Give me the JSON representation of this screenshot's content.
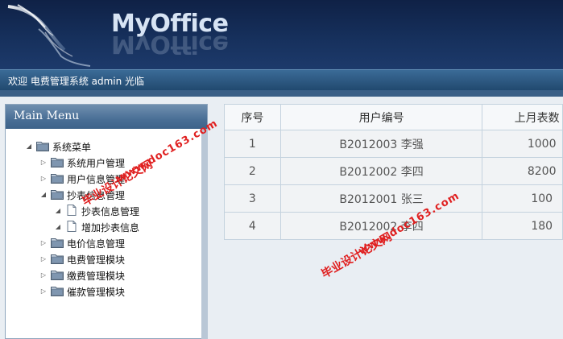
{
  "header": {
    "app_title": "MyOffice"
  },
  "welcome_bar": {
    "text": "欢迎 电费管理系统 admin 光临"
  },
  "sidebar": {
    "title": "Main Menu",
    "tree": [
      {
        "label": "系统菜单",
        "toggle": "◢",
        "icon": "folder-icon",
        "level": 0
      },
      {
        "label": "系统用户管理",
        "toggle": "▷",
        "icon": "folder-icon",
        "level": 1
      },
      {
        "label": "用户信息管理",
        "toggle": "▷",
        "icon": "folder-icon",
        "level": 1
      },
      {
        "label": "抄表信息管理",
        "toggle": "◢",
        "icon": "folder-icon",
        "level": 1
      },
      {
        "label": "抄表信息管理",
        "toggle": "◢",
        "icon": "document-icon",
        "level": 2
      },
      {
        "label": "增加抄表信息",
        "toggle": "◢",
        "icon": "document-icon",
        "level": 2
      },
      {
        "label": "电价信息管理",
        "toggle": "▷",
        "icon": "folder-icon",
        "level": 1
      },
      {
        "label": "电费管理模块",
        "toggle": "▷",
        "icon": "folder-icon",
        "level": 1
      },
      {
        "label": "缴费管理模块",
        "toggle": "▷",
        "icon": "folder-icon",
        "level": 1
      },
      {
        "label": "催款管理模块",
        "toggle": "▷",
        "icon": "folder-icon",
        "level": 1
      }
    ]
  },
  "table": {
    "columns": [
      "序号",
      "用户编号",
      "上月表数"
    ],
    "rows": [
      [
        "1",
        "B2012003 李强",
        "1000"
      ],
      [
        "2",
        "B2012002 李四",
        "8200"
      ],
      [
        "3",
        "B2012001 张三",
        "100"
      ],
      [
        "4",
        "B2012002 李四",
        "180"
      ]
    ]
  },
  "watermarks": {
    "text_cn": "毕业设计论文网",
    "text_url": "www.doc163.com"
  },
  "colors": {
    "header_bg": "#16305c",
    "welcome_bar_bg": "#2b5580",
    "watermark": "#e02020"
  }
}
